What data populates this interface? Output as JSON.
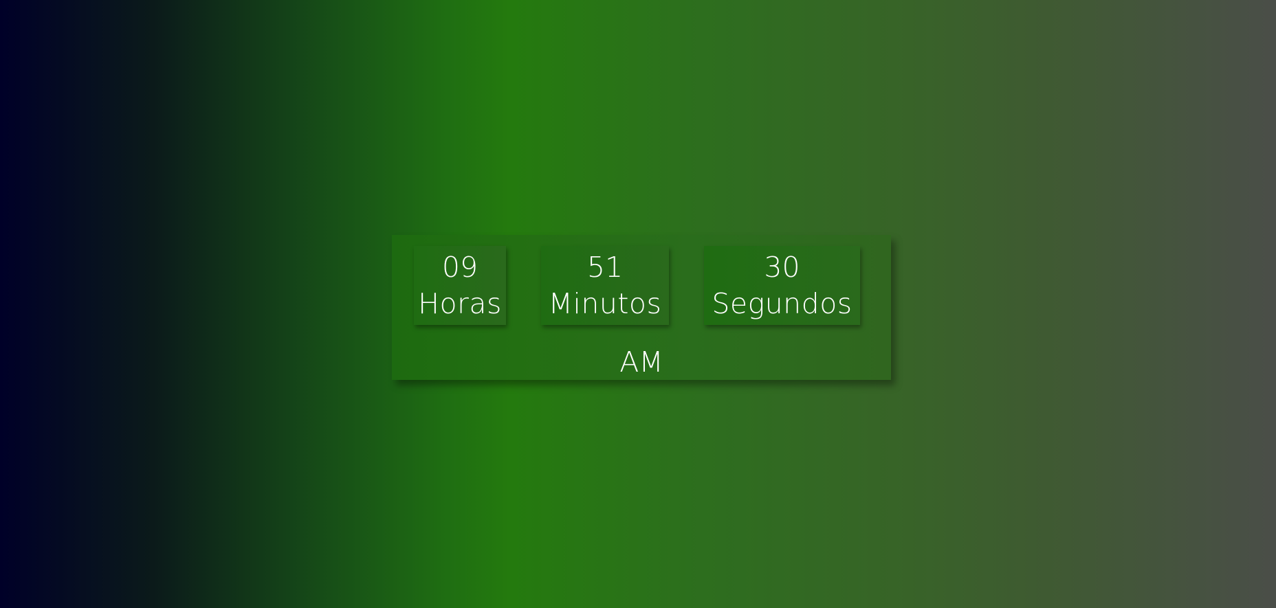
{
  "clock": {
    "hours": {
      "value": "09",
      "label": "Horas"
    },
    "minutes": {
      "value": "51",
      "label": "Minutos"
    },
    "seconds": {
      "value": "30",
      "label": "Segundos"
    },
    "period": "AM"
  },
  "colors": {
    "gradient_start": "#000028",
    "gradient_mid": "#247a0e",
    "gradient_end": "#4a4e48",
    "text": "#ffffff"
  }
}
